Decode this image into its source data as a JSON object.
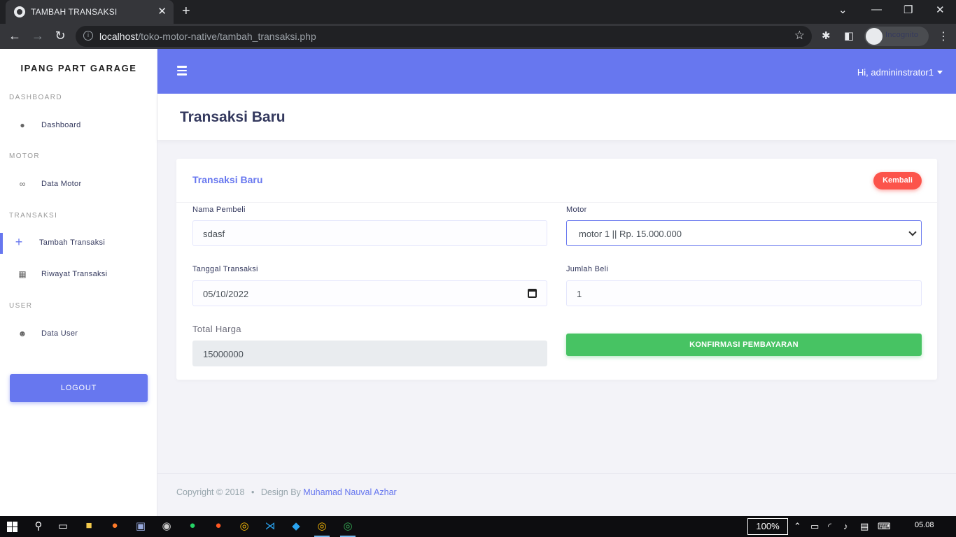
{
  "browser": {
    "tab_title": "TAMBAH TRANSAKSI",
    "url_host": "localhost",
    "url_path": "/toko-motor-native/tambah_transaksi.php",
    "incognito_label": "Incognito"
  },
  "sidebar": {
    "brand": "IPANG PART GARAGE",
    "sections": {
      "dashboard": "DASHBOARD",
      "motor": "MOTOR",
      "transaksi": "TRANSAKSI",
      "user": "USER"
    },
    "items": [
      {
        "label": "Dashboard",
        "icon": "fire-icon"
      },
      {
        "label": "Data Motor",
        "icon": "motorcycle-icon"
      },
      {
        "label": "Tambah Transaksi",
        "icon": "plus-icon",
        "active": true
      },
      {
        "label": "Riwayat Transaksi",
        "icon": "grid-icon"
      },
      {
        "label": "Data User",
        "icon": "users-icon"
      }
    ],
    "logout": "LOGOUT"
  },
  "header": {
    "greeting": "Hi, admininstrator1"
  },
  "page": {
    "title": "Transaksi Baru"
  },
  "card": {
    "title": "Transaksi Baru",
    "back_button": "Kembali",
    "fields": {
      "nama_pembeli": {
        "label": "Nama Pembeli",
        "value": "sdasf"
      },
      "motor": {
        "label": "Motor",
        "value": "motor 1 || Rp. 15.000.000"
      },
      "tanggal": {
        "label": "Tanggal Transaksi",
        "value": "05/10/2022"
      },
      "jumlah": {
        "label": "Jumlah Beli",
        "value": "1"
      },
      "total": {
        "label": "Total Harga",
        "value": "15000000"
      }
    },
    "confirm_button": "KONFIRMASI PEMBAYARAN"
  },
  "footer": {
    "copyright": "Copyright © 2018",
    "separator": "•",
    "design_by": "Design By",
    "author": "Muhamad Nauval Azhar"
  },
  "taskbar": {
    "zoom": "100%",
    "time": "05.08"
  },
  "colors": {
    "primary": "#6777ef",
    "danger": "#fc544b",
    "success": "#47c363"
  }
}
